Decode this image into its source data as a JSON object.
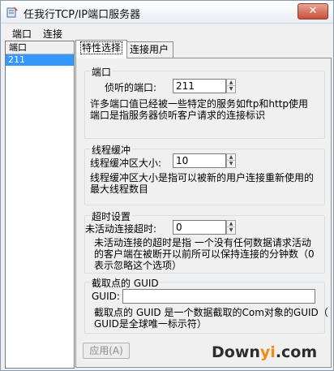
{
  "window": {
    "title": "任我行TCP/IP端口服务器",
    "close_label": "✕"
  },
  "menu": {
    "items": [
      "端口",
      "连接"
    ]
  },
  "port_list": {
    "header": "端口",
    "rows": [
      "211"
    ]
  },
  "tabs": [
    {
      "label": "特性选择",
      "active": true
    },
    {
      "label": "连接用户",
      "active": false
    }
  ],
  "groups": {
    "port": {
      "title": "端口",
      "field_label": "侦听的端口:",
      "value": "211",
      "description_lines": [
        "许多端口值已经被一些特定的服务如ftp和http使用",
        "端口是指服务器侦听客户请求的连接标识"
      ]
    },
    "thread_buffer": {
      "title": "线程缓冲",
      "field_label": "线程缓冲区大小:",
      "value": "10",
      "description_lines": [
        "线程缓冲区大小是指可以被新的用户连接重新使用的",
        "最大线程数目"
      ]
    },
    "timeout": {
      "title": "超时设置",
      "field_label": "未活动连接超时:",
      "value": "0",
      "description_lines": [
        "未活动连接的超时是指 一个没有任何数据请求活动",
        "的客户端在被断开以前所可以保持连接的分钟数（0",
        "表示忽略这个选项）"
      ]
    },
    "guid": {
      "title": "截取点的 GUID",
      "field_label": "GUID:",
      "value": "",
      "description_lines": [
        "截取点的 GUID 是一个数据截取的Com对象的GUID（",
        "GUID是全球唯一标示符）"
      ]
    }
  },
  "apply_button": "应用(A)",
  "watermark": {
    "dark": "Down",
    "orange": "yi",
    "tail": ".com"
  }
}
